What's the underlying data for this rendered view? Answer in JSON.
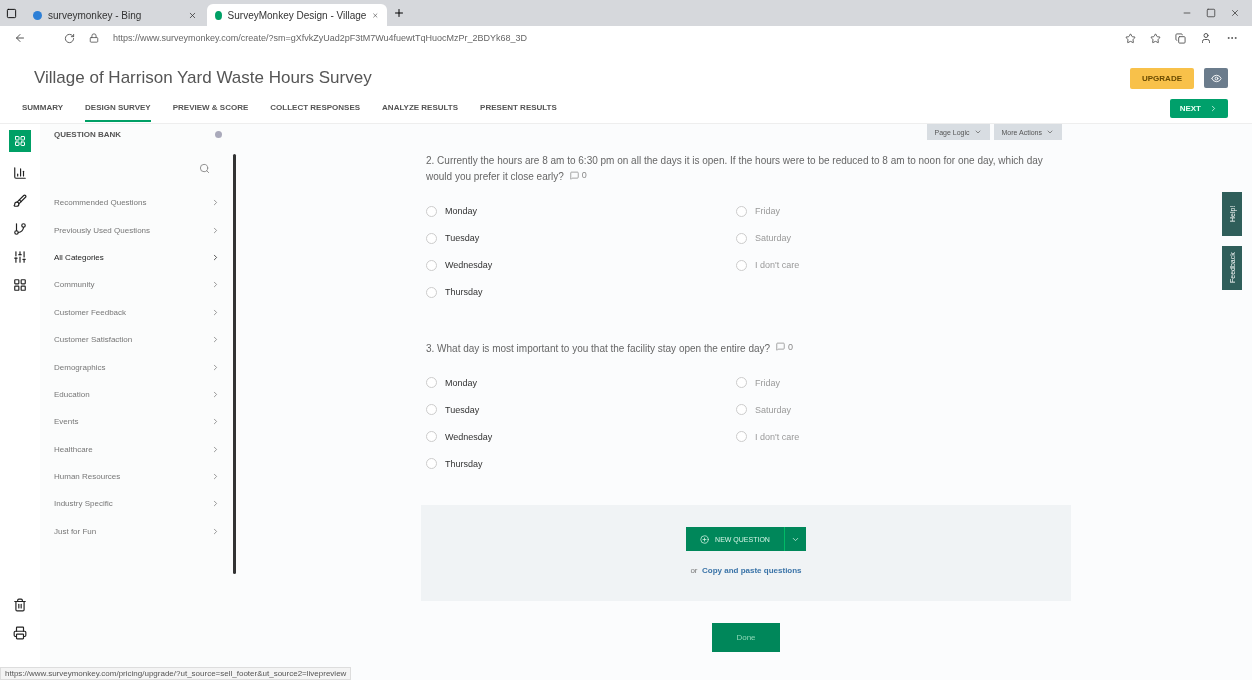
{
  "browser": {
    "tabs": [
      {
        "title": "surveymonkey - Bing",
        "selected": false
      },
      {
        "title": "SurveyMonkey Design - Village",
        "selected": true
      }
    ],
    "url": "https://www.surveymonkey.com/create/?sm=gXfvkZyUad2pF3tM7Wu4fuewtTqHuocMzPr_2BDYk68_3D"
  },
  "survey_title": "Village of Harrison Yard Waste Hours Survey",
  "header_buttons": [
    {
      "kind": "upgrade",
      "label": "UPGRADE"
    },
    {
      "kind": "next",
      "label": "NEXT"
    }
  ],
  "nav_tabs": [
    {
      "label": "SUMMARY",
      "selected": false
    },
    {
      "label": "DESIGN SURVEY",
      "selected": true
    },
    {
      "label": "PREVIEW & SCORE",
      "selected": false
    },
    {
      "label": "COLLECT RESPONSES",
      "selected": false
    },
    {
      "label": "ANALYZE RESULTS",
      "selected": false
    },
    {
      "label": "PRESENT RESULTS",
      "selected": false
    }
  ],
  "question_bank": {
    "title": "QUESTION BANK",
    "items": [
      {
        "label": "Recommended Questions",
        "selected": false
      },
      {
        "label": "Previously Used Questions",
        "selected": false
      },
      {
        "label": "All Categories",
        "selected": true
      },
      {
        "label": "Community",
        "selected": false
      },
      {
        "label": "Customer Feedback",
        "selected": false
      },
      {
        "label": "Customer Satisfaction",
        "selected": false
      },
      {
        "label": "Demographics",
        "selected": false
      },
      {
        "label": "Education",
        "selected": false
      },
      {
        "label": "Events",
        "selected": false
      },
      {
        "label": "Healthcare",
        "selected": false
      },
      {
        "label": "Human Resources",
        "selected": false
      },
      {
        "label": "Industry Specific",
        "selected": false
      },
      {
        "label": "Just for Fun",
        "selected": false
      }
    ]
  },
  "toolbar": [
    "Page Logic",
    "More Actions"
  ],
  "questions": [
    {
      "text": "2. Currently the hours are 8 am to 6:30 pm on all the days it is open.  If the hours were to be reduced to 8 am to noon for one day, which day would you prefer it close early?",
      "comments": "0",
      "options": [
        {
          "label": "Monday",
          "selected": false
        },
        {
          "label": "Tuesday",
          "selected": false
        },
        {
          "label": "Wednesday",
          "selected": false
        },
        {
          "label": "Thursday",
          "selected": false
        },
        {
          "label": "Friday",
          "selected": false
        },
        {
          "label": "Saturday",
          "selected": false
        },
        {
          "label": "I don't care",
          "selected": false
        }
      ]
    },
    {
      "text": "3. What day is most important to you that the facility stay open the entire day?",
      "comments": "0",
      "options": [
        {
          "label": "Monday",
          "selected": false
        },
        {
          "label": "Tuesday",
          "selected": false
        },
        {
          "label": "Wednesday",
          "selected": false
        },
        {
          "label": "Thursday",
          "selected": false
        },
        {
          "label": "Friday",
          "selected": false
        },
        {
          "label": "Saturday",
          "selected": false
        },
        {
          "label": "I don't care",
          "selected": false
        }
      ]
    }
  ],
  "new_question": {
    "label": "NEW QUESTION",
    "prefix": "or",
    "link": "Copy and paste questions"
  },
  "done": "Done",
  "side_tabs": [
    "Help!",
    "Feedback"
  ],
  "status_url": "https://www.surveymonkey.com/pricing/upgrade/?ut_source=sell_footer&ut_source2=livepreview"
}
